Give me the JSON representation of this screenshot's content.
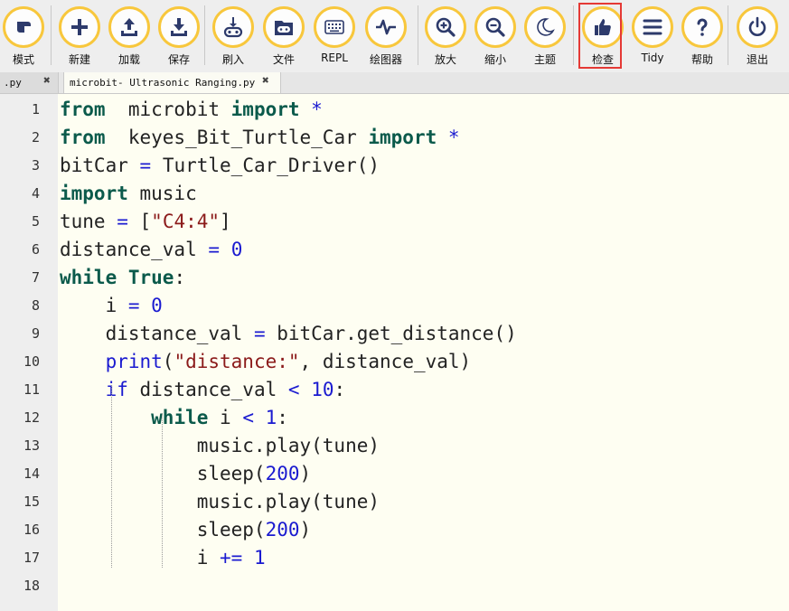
{
  "toolbar": {
    "buttons": [
      {
        "label": "模式",
        "icon": "mode-icon"
      },
      {
        "label": "新建",
        "icon": "plus-icon"
      },
      {
        "label": "加载",
        "icon": "upload-icon"
      },
      {
        "label": "保存",
        "icon": "download-icon"
      },
      {
        "label": "刷入",
        "icon": "flash-icon"
      },
      {
        "label": "文件",
        "icon": "folder-icon"
      },
      {
        "label": "REPL",
        "icon": "keyboard-icon"
      },
      {
        "label": "绘图器",
        "icon": "waveform-icon"
      },
      {
        "label": "放大",
        "icon": "zoom-in-icon"
      },
      {
        "label": "缩小",
        "icon": "zoom-out-icon"
      },
      {
        "label": "主题",
        "icon": "moon-icon"
      },
      {
        "label": "检查",
        "icon": "thumbs-up-icon"
      },
      {
        "label": "Tidy",
        "icon": "lines-icon"
      },
      {
        "label": "帮助",
        "icon": "question-icon"
      },
      {
        "label": "退出",
        "icon": "power-icon"
      }
    ],
    "accent_color": "#f8c73c",
    "highlight_color": "#e53935"
  },
  "tabs": [
    {
      "label": ".py",
      "close": "✖"
    },
    {
      "label": "microbit- Ultrasonic Ranging.py",
      "close": "✖"
    }
  ],
  "editor": {
    "line_numbers": [
      "1",
      "2",
      "3",
      "4",
      "5",
      "6",
      "7",
      "8",
      "9",
      "10",
      "11",
      "12",
      "13",
      "14",
      "15",
      "16",
      "17",
      "18"
    ],
    "lines": [
      [
        [
          "kw",
          "from"
        ],
        [
          "",
          "  microbit "
        ],
        [
          "kw",
          "import"
        ],
        [
          "op",
          " *"
        ]
      ],
      [
        [
          "kw",
          "from"
        ],
        [
          "",
          "  keyes_Bit_Turtle_Car "
        ],
        [
          "kw",
          "import"
        ],
        [
          "op",
          " *"
        ]
      ],
      [
        [
          "",
          "bitCar "
        ],
        [
          "op",
          "="
        ],
        [
          "",
          " Turtle_Car_Driver()"
        ]
      ],
      [
        [
          "kw",
          "import"
        ],
        [
          "",
          " music"
        ]
      ],
      [
        [
          "",
          "tune "
        ],
        [
          "op",
          "="
        ],
        [
          "",
          " ["
        ],
        [
          "str",
          "\"C4:4\""
        ],
        [
          "",
          "]"
        ]
      ],
      [
        [
          "",
          "distance_val "
        ],
        [
          "op",
          "="
        ],
        [
          "",
          " "
        ],
        [
          "num",
          "0"
        ]
      ],
      [
        [
          "kw",
          "while"
        ],
        [
          "",
          " "
        ],
        [
          "kw",
          "True"
        ],
        [
          "",
          ":"
        ]
      ],
      [
        [
          "",
          "    i "
        ],
        [
          "op",
          "="
        ],
        [
          "",
          " "
        ],
        [
          "num",
          "0"
        ]
      ],
      [
        [
          "",
          "    distance_val "
        ],
        [
          "op",
          "="
        ],
        [
          "",
          " bitCar.get_distance()"
        ]
      ],
      [
        [
          "",
          "    "
        ],
        [
          "ctl",
          "print"
        ],
        [
          "",
          "("
        ],
        [
          "str",
          "\"distance:\""
        ],
        [
          "",
          ", distance_val)"
        ]
      ],
      [
        [
          "",
          "    "
        ],
        [
          "ctl",
          "if"
        ],
        [
          "",
          " distance_val "
        ],
        [
          "op",
          "<"
        ],
        [
          "",
          " "
        ],
        [
          "num",
          "10"
        ],
        [
          "",
          ":"
        ]
      ],
      [
        [
          "",
          "        "
        ],
        [
          "kw",
          "while"
        ],
        [
          "",
          " i "
        ],
        [
          "op",
          "<"
        ],
        [
          "",
          " "
        ],
        [
          "num",
          "1"
        ],
        [
          "",
          ":"
        ]
      ],
      [
        [
          "",
          "            music.play(tune)"
        ]
      ],
      [
        [
          "",
          "            sleep("
        ],
        [
          "num",
          "200"
        ],
        [
          "",
          ")"
        ]
      ],
      [
        [
          "",
          "            music.play(tune)"
        ]
      ],
      [
        [
          "",
          "            sleep("
        ],
        [
          "num",
          "200"
        ],
        [
          "",
          ")"
        ]
      ],
      [
        [
          "",
          "            i "
        ],
        [
          "op",
          "+="
        ],
        [
          "",
          " "
        ],
        [
          "num",
          "1"
        ]
      ],
      [
        [
          "",
          ""
        ]
      ]
    ],
    "background": "#fefef2"
  }
}
